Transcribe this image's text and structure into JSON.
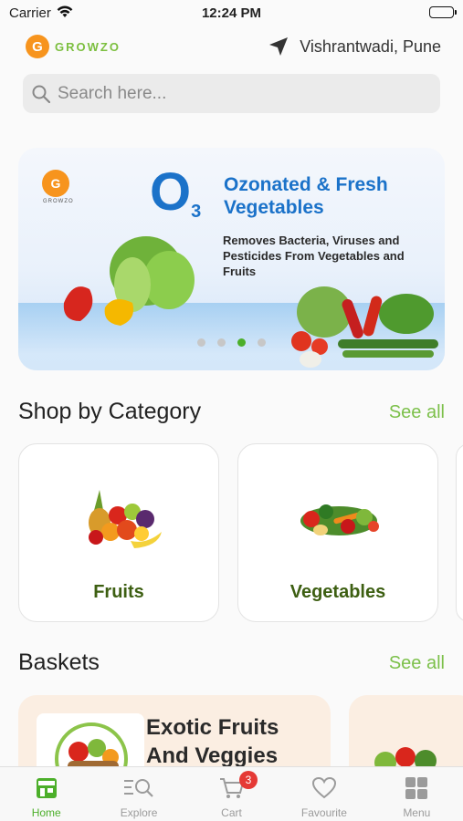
{
  "status_bar": {
    "carrier": "Carrier",
    "time": "12:24 PM"
  },
  "header": {
    "brand": "GROWZO",
    "location": "Vishrantwadi, Pune"
  },
  "search": {
    "placeholder": "Search here..."
  },
  "banner": {
    "logo_text": "GROWZO",
    "o3": "O",
    "o3_sub": "3",
    "title": "Ozonated & Fresh Vegetables",
    "subtitle": "Removes Bacteria, Viruses and Pesticides From Vegetables and Fruits",
    "slide_count": 4,
    "active_slide": 3
  },
  "categories": {
    "title": "Shop by Category",
    "see_all": "See all",
    "items": [
      {
        "label": "Fruits"
      },
      {
        "label": "Vegetables"
      }
    ]
  },
  "baskets": {
    "title": "Baskets",
    "see_all": "See all",
    "items": [
      {
        "title": "Exotic Fruits And Veggies"
      }
    ]
  },
  "tabbar": {
    "tabs": [
      {
        "label": "Home",
        "icon": "store-icon"
      },
      {
        "label": "Explore",
        "icon": "explore-icon"
      },
      {
        "label": "Cart",
        "icon": "cart-icon"
      },
      {
        "label": "Favourite",
        "icon": "heart-icon"
      },
      {
        "label": "Menu",
        "icon": "grid-icon"
      }
    ],
    "cart_badge": "3",
    "active_tab": "Home"
  },
  "colors": {
    "accent": "#4caf2a",
    "brand_orange": "#f7941d",
    "banner_blue": "#1b72c9",
    "category_label": "#3d5f12"
  }
}
